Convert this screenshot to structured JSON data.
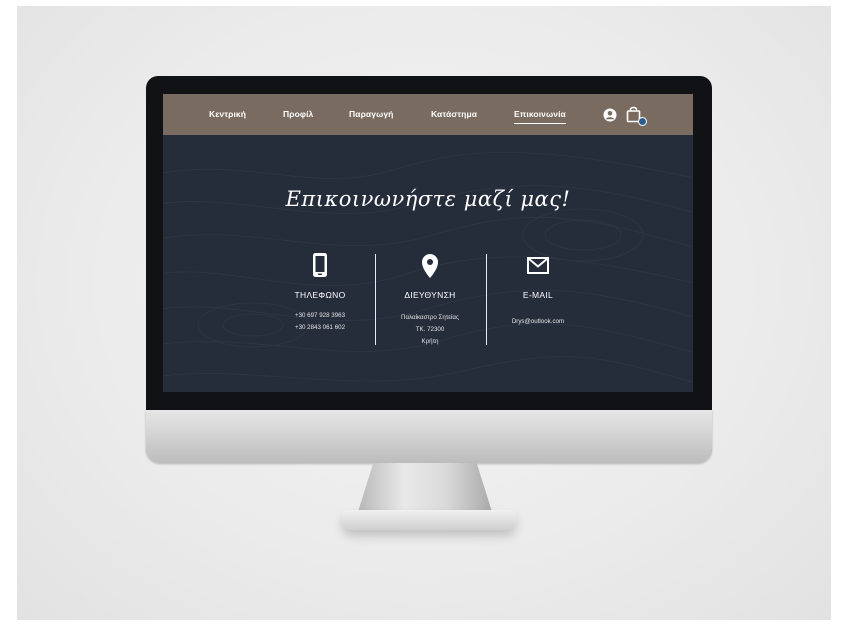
{
  "nav": {
    "items": [
      {
        "label": "Κεντρική"
      },
      {
        "label": "Προφίλ"
      },
      {
        "label": "Παραγωγή"
      },
      {
        "label": "Κατάστημα"
      },
      {
        "label": "Επικοινωνία",
        "active": true
      }
    ],
    "user_icon": "user-icon",
    "cart_icon": "shopping-bag-icon"
  },
  "page": {
    "title": "Επικοινωνήστε μαζί μας!"
  },
  "contact": {
    "phone": {
      "icon": "phone-icon",
      "heading": "ΤΗΛΕΦΩΝΟ",
      "lines": [
        "+30 697 928 3963",
        "+30 2843 061 602"
      ]
    },
    "address": {
      "icon": "location-pin-icon",
      "heading": "ΔΙΕΥΘΥΝΣΗ",
      "lines": [
        "Παλαίκαστρο Σητείας",
        "ΤΚ. 72300",
        "Κρήτη"
      ]
    },
    "email": {
      "icon": "envelope-icon",
      "heading": "E-MAIL",
      "lines": [
        "Drys@outlook.com"
      ]
    }
  },
  "colors": {
    "navbar": "#796b5f",
    "screen_bg": "#252c3a",
    "text": "#ffffff",
    "cart_badge": "#2c5d8a"
  }
}
